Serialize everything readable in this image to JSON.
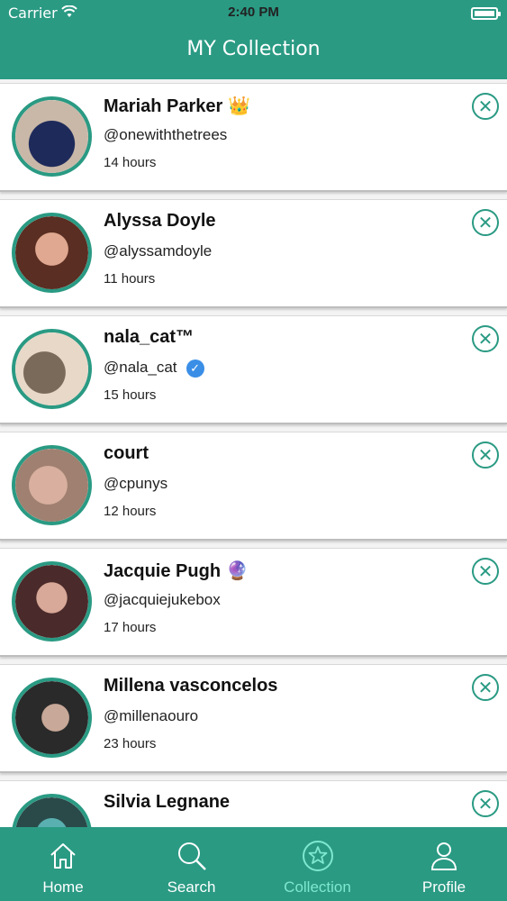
{
  "status_bar": {
    "carrier": "Carrier",
    "time": "2:40 PM"
  },
  "nav": {
    "title": "MY Collection"
  },
  "collection": [
    {
      "name": "Mariah Parker",
      "emoji": "👑",
      "handle": "@onewiththetrees",
      "time": "14 hours",
      "verified": false
    },
    {
      "name": "Alyssa Doyle",
      "emoji": "",
      "handle": "@alyssamdoyle",
      "time": "11 hours",
      "verified": false
    },
    {
      "name": "nala_cat™",
      "emoji": "",
      "handle": "@nala_cat",
      "time": "15 hours",
      "verified": true
    },
    {
      "name": "court",
      "emoji": "",
      "handle": "@cpunys",
      "time": "12 hours",
      "verified": false
    },
    {
      "name": "Jacquie Pugh",
      "emoji": "🔮",
      "handle": "@jacquiejukebox",
      "time": "17 hours",
      "verified": false
    },
    {
      "name": "Millena vasconcelos",
      "emoji": "",
      "handle": "@millenaouro",
      "time": "23 hours",
      "verified": false
    },
    {
      "name": "Silvia Legnane",
      "emoji": "",
      "handle": "",
      "time": "",
      "verified": false
    }
  ],
  "tabbar": {
    "home": "Home",
    "search": "Search",
    "collection": "Collection",
    "profile": "Profile"
  },
  "colors": {
    "brand": "#2a9a83",
    "active_tab": "#7fe8cf",
    "verified": "#3a8ee6"
  },
  "icons": {
    "remove": "circle-x-icon",
    "home": "home-icon",
    "search": "search-icon",
    "collection": "star-circle-icon",
    "profile": "person-icon"
  }
}
